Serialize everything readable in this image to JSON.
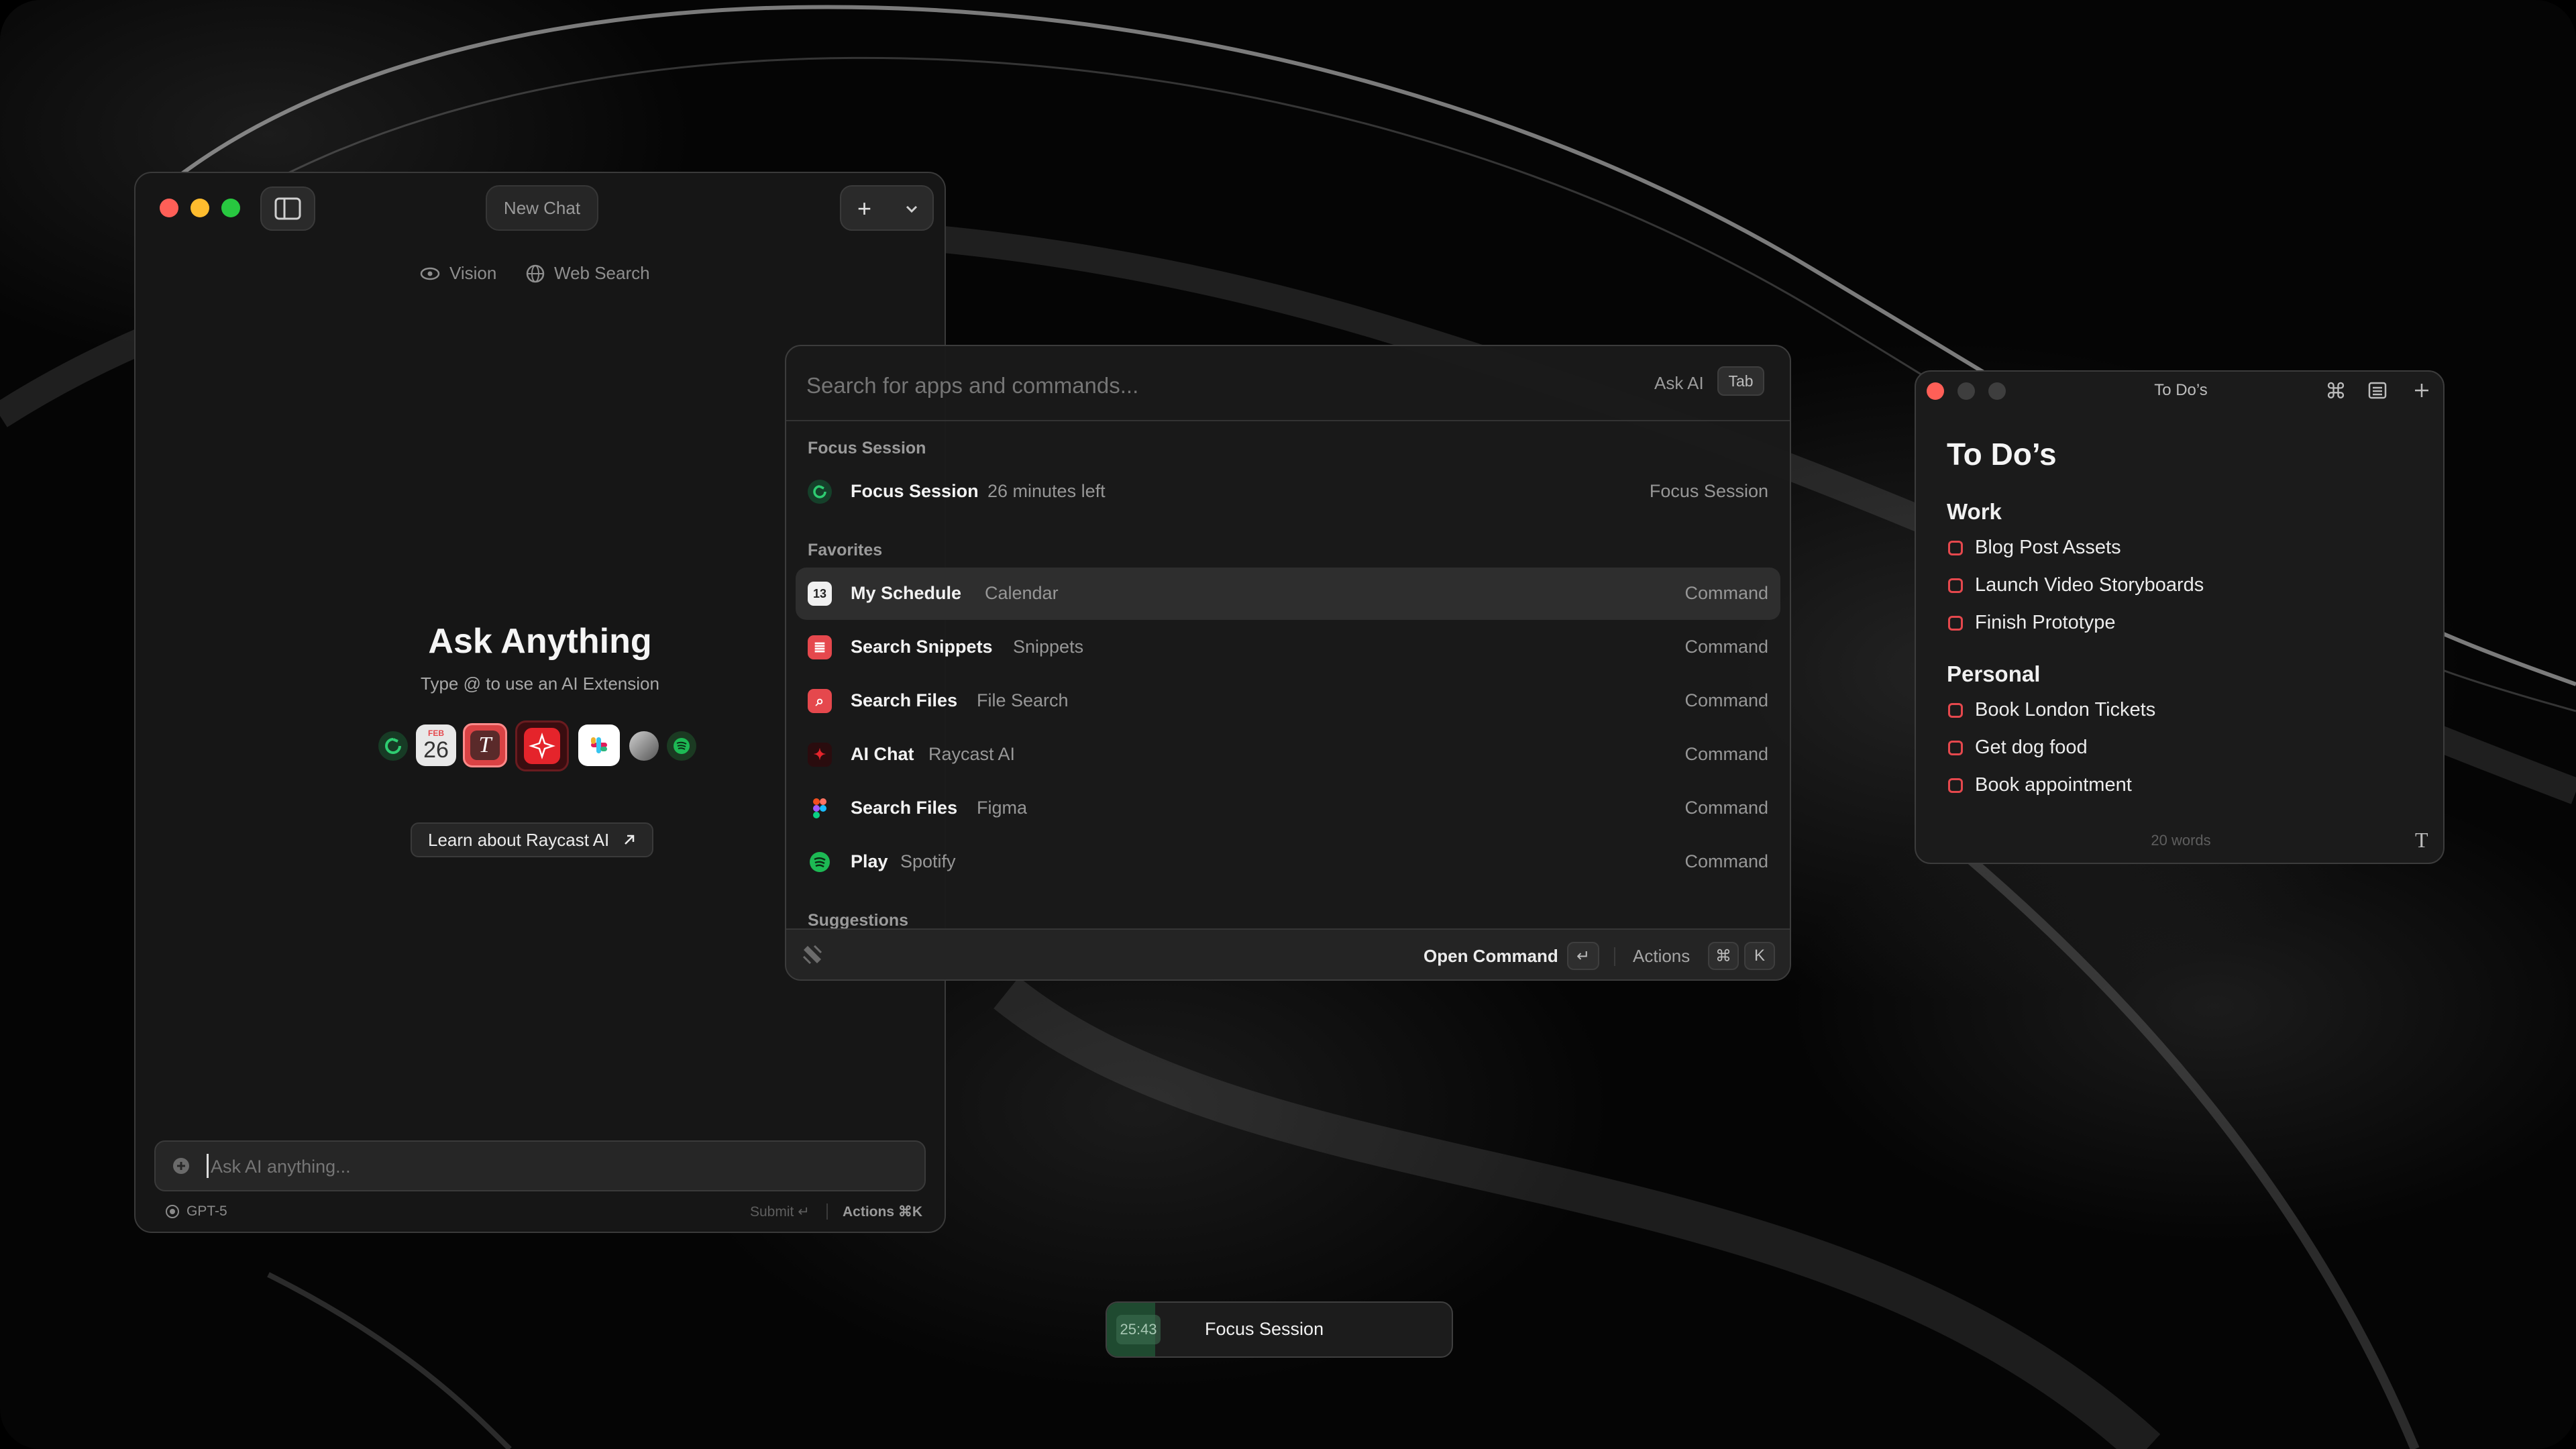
{
  "colors": {
    "close": "#ff5f57",
    "minimize": "#febc2e",
    "zoom": "#28c840",
    "accent_red": "#e5484d",
    "spotify_green": "#1db954",
    "focus_green": "#1f9d55"
  },
  "chat": {
    "title": "New Chat",
    "sidebar_icon": "sidebar-toggle-icon",
    "new_button_label": "+",
    "dropdown_icon": "chevron-down-icon",
    "options": [
      {
        "label": "Vision",
        "icon": "eye-icon"
      },
      {
        "label": "Web Search",
        "icon": "globe-icon"
      }
    ],
    "heading": "Ask Anything",
    "subheading": "Type @ to use an AI Extension",
    "extensions": [
      {
        "name": "focus-extension-icon"
      },
      {
        "name": "calendar-extension-icon",
        "month": "FEB",
        "day": "26"
      },
      {
        "name": "text-extension-icon",
        "glyph": "T"
      },
      {
        "name": "raycast-ai-extension-icon"
      },
      {
        "name": "slack-extension-icon"
      },
      {
        "name": "linear-extension-icon"
      },
      {
        "name": "spotify-extension-icon"
      }
    ],
    "learn_button": "Learn about Raycast AI",
    "input_placeholder": "Ask AI anything...",
    "model": "GPT-5",
    "submit_hint": "Submit ↵",
    "actions_hint": "Actions ⌘K"
  },
  "launcher": {
    "search_placeholder": "Search for apps and commands...",
    "ask_ai_label": "Ask AI",
    "tab_key": "Tab",
    "sections": {
      "focus": "Focus Session",
      "favorites": "Favorites",
      "suggestions": "Suggestions"
    },
    "focus_row": {
      "title": "Focus Session",
      "subtitle": "26 minutes left",
      "accessory": "Focus Session"
    },
    "favorites": [
      {
        "title": "My Schedule",
        "subtitle": "Calendar",
        "accessory": "Command",
        "icon": "calendar-icon",
        "glyph": "13"
      },
      {
        "title": "Search Snippets",
        "subtitle": "Snippets",
        "accessory": "Command",
        "icon": "snippets-icon",
        "glyph": "≣"
      },
      {
        "title": "Search Files",
        "subtitle": "File Search",
        "accessory": "Command",
        "icon": "file-search-icon",
        "glyph": "⌕"
      },
      {
        "title": "AI Chat",
        "subtitle": "Raycast AI",
        "accessory": "Command",
        "icon": "raycast-ai-icon",
        "glyph": "✦"
      },
      {
        "title": "Search Files",
        "subtitle": "Figma",
        "accessory": "Command",
        "icon": "figma-icon",
        "glyph": ""
      },
      {
        "title": "Play",
        "subtitle": "Spotify",
        "accessory": "Command",
        "icon": "spotify-icon",
        "glyph": ""
      }
    ],
    "footer": {
      "primary_action": "Open Command",
      "enter_key": "↵",
      "actions_label": "Actions",
      "cmd_key": "⌘",
      "k_key": "K"
    }
  },
  "notes": {
    "window_title": "To Do’s",
    "heading": "To Do’s",
    "sections": [
      {
        "title": "Work",
        "items": [
          "Blog Post Assets",
          "Launch Video Storyboards",
          "Finish Prototype"
        ]
      },
      {
        "title": "Personal",
        "items": [
          "Book London Tickets",
          "Get dog food",
          "Book appointment"
        ]
      }
    ],
    "word_count": "20 words",
    "toolbar_icons": [
      "command-icon",
      "list-icon",
      "plus-icon"
    ],
    "format_icon_glyph": "T"
  },
  "focus_timer": {
    "time": "25:43",
    "label": "Focus Session",
    "progress_fraction": 0.14
  }
}
